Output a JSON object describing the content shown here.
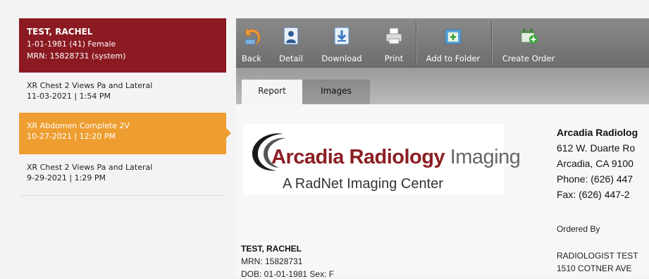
{
  "patient": {
    "name": "TEST, RACHEL",
    "dob_line": "1-01-1981 (41) Female",
    "mrn_line": "MRN: 15828731 (system)"
  },
  "studies": [
    {
      "title": "XR Chest 2 Views Pa and Lateral",
      "datetime": "11-03-2021 | 1:54 PM",
      "selected": false
    },
    {
      "title": "XR Abdomen Complete 2V",
      "datetime": "10-27-2021 | 12:20 PM",
      "selected": true
    },
    {
      "title": "XR Chest 2 Views Pa and Lateral",
      "datetime": "9-29-2021 | 1:29 PM",
      "selected": false
    }
  ],
  "toolbar": {
    "back": "Back",
    "detail": "Detail",
    "download": "Download",
    "print": "Print",
    "add_to_folder": "Add to Folder",
    "create_order": "Create Order"
  },
  "tabs": {
    "report": "Report",
    "images": "Images"
  },
  "report": {
    "logo_brand": "Arcadia Radiology",
    "logo_word": "Imaging",
    "logo_tagline": "A RadNet Imaging Center",
    "facility_name": "Arcadia Radiolog",
    "facility_address1": "612 W. Duarte Ro",
    "facility_address2": "Arcadia, CA 9100",
    "facility_phone": "Phone: (626) 447",
    "facility_fax": "Fax:  (626) 447-2",
    "ordered_by_label": "Ordered By",
    "ordered_by_name": "RADIOLOGIST TEST",
    "ordered_by_address": "1510 COTNER AVE",
    "patient_name": "TEST, RACHEL",
    "patient_mrn": "MRN: 15828731",
    "patient_dob_sex": "DOB: 01-01-1981    Sex: F"
  },
  "colors": {
    "patient_header_bg": "#8b1a22",
    "selected_study_bg": "#ee9e31",
    "toolbar_bg": "#7c7c7c",
    "logo_red": "#8b1f24"
  },
  "icons": [
    "back-arrow-icon",
    "detail-person-icon",
    "download-icon",
    "printer-icon",
    "add-to-folder-icon",
    "create-order-icon"
  ]
}
